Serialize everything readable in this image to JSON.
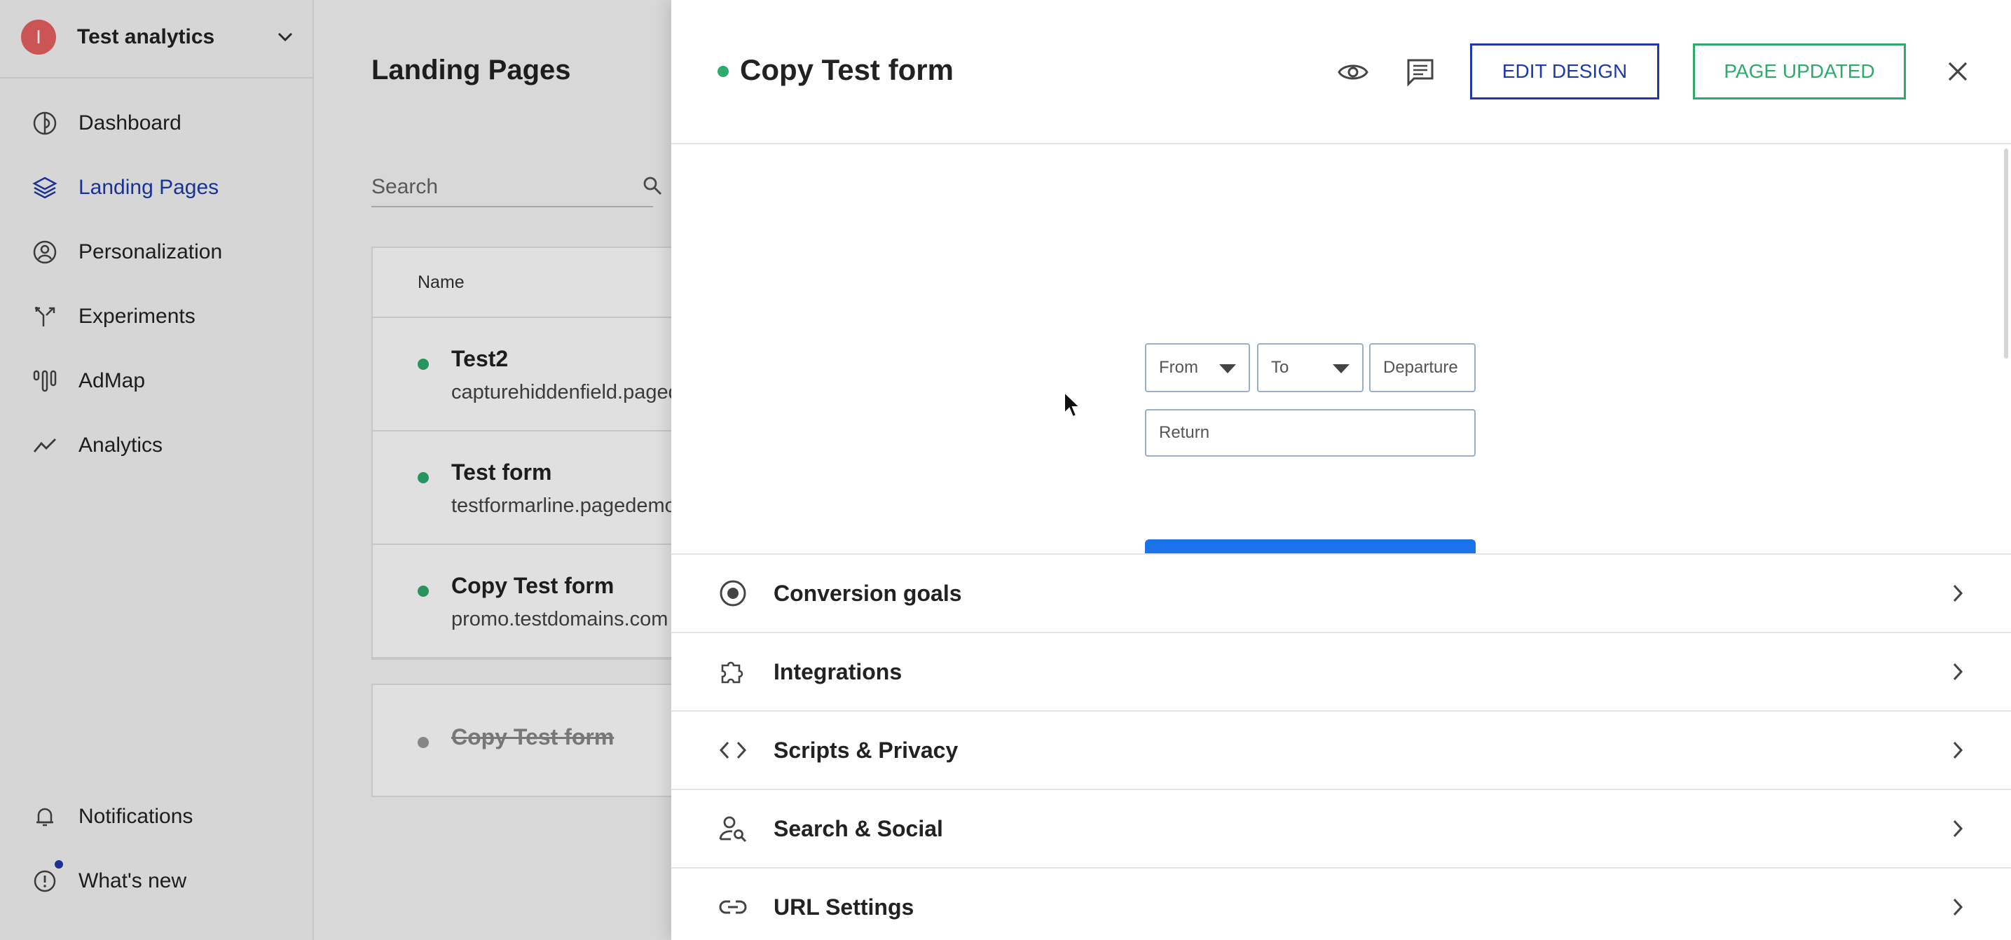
{
  "sidebar": {
    "workspace": {
      "initial": "I",
      "name": "Test analytics"
    },
    "items": [
      {
        "label": "Dashboard",
        "icon": "dashboard-icon"
      },
      {
        "label": "Landing Pages",
        "icon": "layers-icon",
        "active": true
      },
      {
        "label": "Personalization",
        "icon": "user-circle-icon"
      },
      {
        "label": "Experiments",
        "icon": "split-arrow-icon"
      },
      {
        "label": "AdMap",
        "icon": "admap-icon"
      },
      {
        "label": "Analytics",
        "icon": "trend-line-icon"
      }
    ],
    "bottom_items": [
      {
        "label": "Notifications",
        "icon": "bell-icon"
      },
      {
        "label": "What's new",
        "icon": "info-circle-icon"
      }
    ]
  },
  "landing": {
    "title": "Landing Pages",
    "search_placeholder": "Search",
    "column_name": "Name",
    "rows": [
      {
        "title": "Test2",
        "url": "capturehiddenfield.pagedem"
      },
      {
        "title": "Test form",
        "url": "testformarline.pagedemo"
      },
      {
        "title": "Copy Test form",
        "url": "promo.testdomains.com"
      }
    ],
    "archived": {
      "title": "Copy Test form"
    }
  },
  "drawer": {
    "title": "Copy Test form",
    "edit_label": "EDIT DESIGN",
    "updated_label": "PAGE UPDATED",
    "preview": {
      "from_label": "From",
      "to_label": "To",
      "departure_placeholder": "Departure",
      "return_placeholder": "Return"
    },
    "sections": [
      {
        "label": "Conversion goals",
        "icon": "target-icon"
      },
      {
        "label": "Integrations",
        "icon": "puzzle-icon"
      },
      {
        "label": "Scripts & Privacy",
        "icon": "code-icon"
      },
      {
        "label": "Search & Social",
        "icon": "user-search-icon"
      },
      {
        "label": "URL Settings",
        "icon": "link-icon"
      }
    ]
  },
  "colors": {
    "accent": "#1f3aa8",
    "success": "#2eaa6b",
    "avatar": "#e86060",
    "preview_button": "#1a73e8"
  }
}
